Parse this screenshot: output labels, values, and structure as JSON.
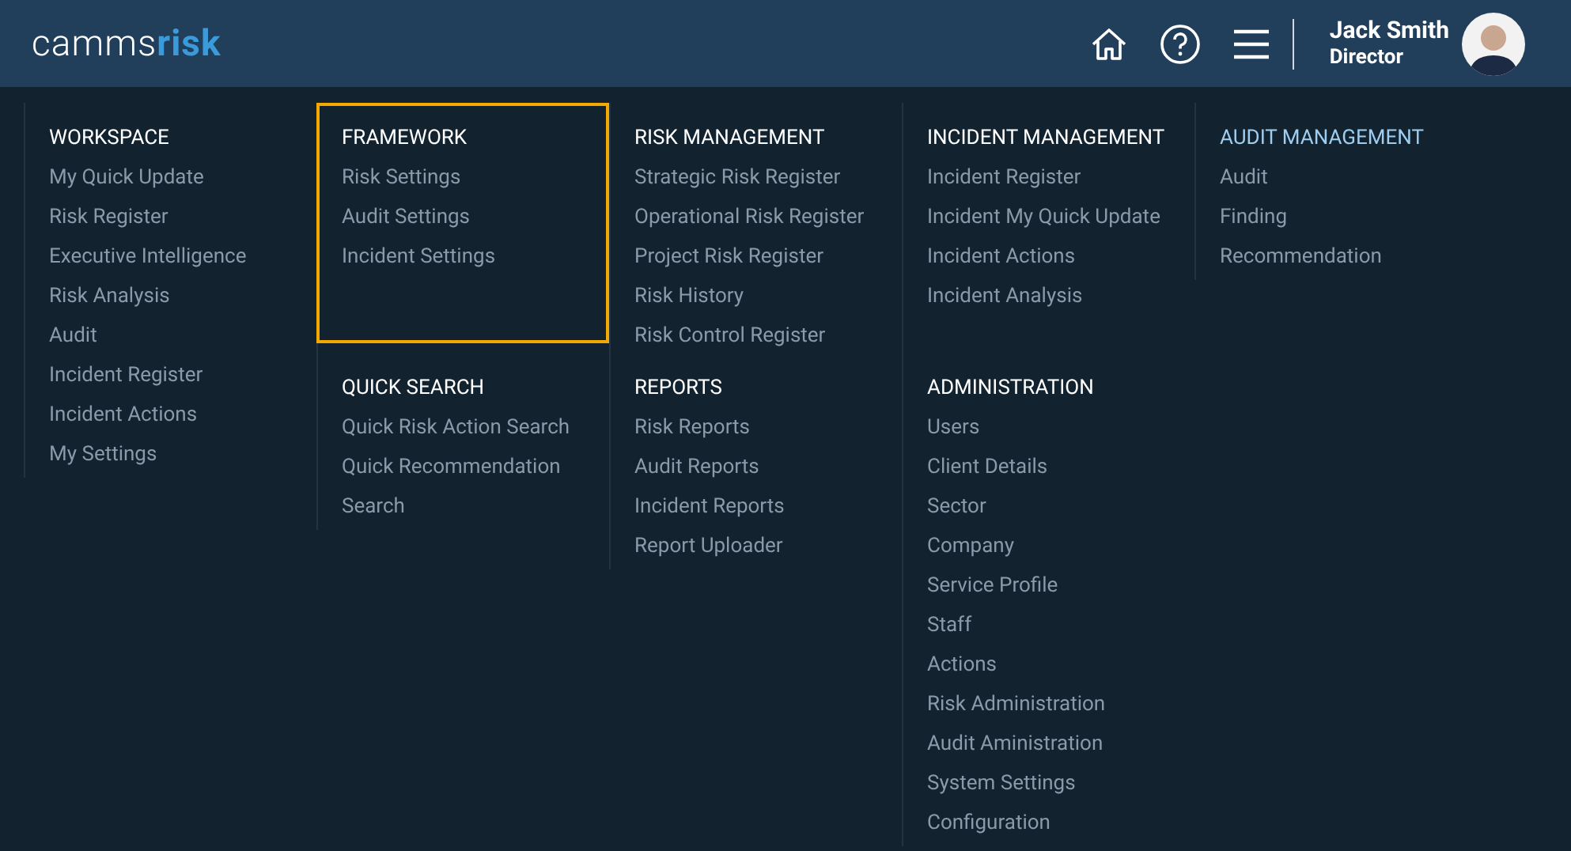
{
  "header": {
    "logo": {
      "part_1": "camms",
      "part_2": "risk"
    },
    "user": {
      "name": "Jack Smith",
      "role": "Director"
    }
  },
  "columns": [
    {
      "sections": [
        {
          "title": "WORKSPACE",
          "selected": false,
          "highlighted": false,
          "items": [
            "My Quick Update",
            "Risk Register",
            "Executive Intelligence",
            "Risk Analysis",
            "Audit",
            "Incident Register",
            "Incident Actions",
            "My Settings"
          ]
        }
      ]
    },
    {
      "sections": [
        {
          "title": "FRAMEWORK",
          "selected": false,
          "highlighted": true,
          "items": [
            "Risk Settings",
            "Audit Settings",
            "Incident Settings"
          ]
        },
        {
          "title": "QUICK SEARCH",
          "selected": false,
          "highlighted": false,
          "items": [
            "Quick Risk Action Search",
            "Quick Recommendation",
            "Search"
          ]
        }
      ]
    },
    {
      "sections": [
        {
          "title": "RISK MANAGEMENT",
          "selected": false,
          "highlighted": false,
          "items": [
            "Strategic Risk Register",
            "Operational Risk Register",
            "Project Risk Register",
            "Risk History",
            "Risk Control Register"
          ]
        },
        {
          "title": "REPORTS",
          "selected": false,
          "highlighted": false,
          "items": [
            "Risk Reports",
            "Audit Reports",
            "Incident Reports",
            "Report Uploader"
          ]
        }
      ]
    },
    {
      "sections": [
        {
          "title": "INCIDENT MANAGEMENT",
          "selected": false,
          "highlighted": false,
          "items": [
            "Incident Register",
            "Incident My Quick Update",
            "Incident Actions",
            "Incident Analysis"
          ]
        },
        {
          "title": "ADMINISTRATION",
          "selected": false,
          "highlighted": false,
          "items": [
            "Users",
            "Client Details",
            "Sector",
            "Company",
            "Service Profile",
            "Staff",
            "Actions",
            "Risk Administration",
            "Audit Aministration",
            "System Settings",
            "Configuration"
          ]
        }
      ]
    },
    {
      "sections": [
        {
          "title": "AUDIT MANAGEMENT",
          "selected": true,
          "highlighted": false,
          "items": [
            "Audit",
            "Finding",
            "Recommendation"
          ]
        }
      ]
    }
  ]
}
